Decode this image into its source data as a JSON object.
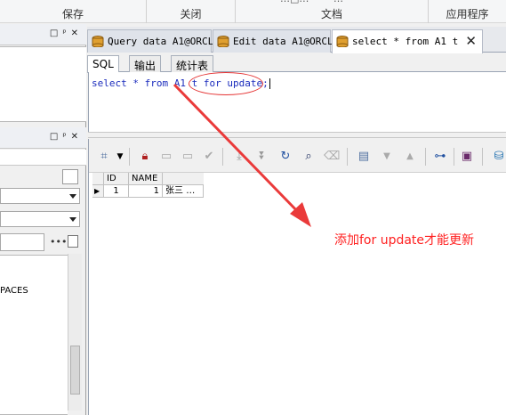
{
  "topbar": {
    "groups": [
      "保存",
      "关闭",
      "文档",
      "应用程序"
    ],
    "partial_label": "…□…~~~…"
  },
  "editor_tabs": [
    {
      "label": "Query data A1@ORCL",
      "active": false
    },
    {
      "label": "Edit data A1@ORCL",
      "active": false
    },
    {
      "label": "select * from A1 t",
      "active": true
    }
  ],
  "sub_tabs": [
    {
      "label": "SQL",
      "active": true
    },
    {
      "label": "输出",
      "active": false
    },
    {
      "label": "统计表",
      "active": false
    }
  ],
  "editor": {
    "sql_plain": "select * from A1 t ",
    "sql_highlight": "for update;"
  },
  "left_panel": {
    "tree_item": "PACES"
  },
  "grid": {
    "headers": [
      "",
      "ID",
      "NAME"
    ],
    "rows": [
      {
        "row_no": "1",
        "ID": "1",
        "NAME": "张三",
        "ellipsis": "…"
      }
    ]
  },
  "annotation": {
    "text": "添加for update才能更新",
    "color": "#ff2020"
  },
  "colors": {
    "keyword": "#1c2dbd",
    "annotation_red": "#e53333"
  }
}
